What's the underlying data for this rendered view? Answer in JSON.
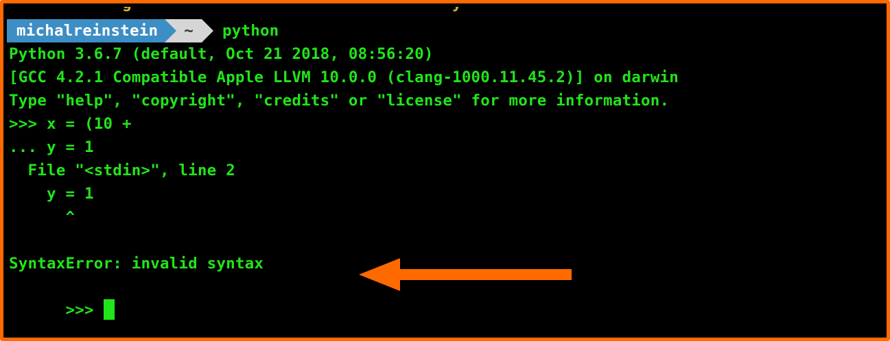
{
  "terminal": {
    "partial_top_line": "            g                                  y",
    "prompt": {
      "user": "michalreinstein",
      "directory": "~",
      "command": "python"
    },
    "lines": [
      "Python 3.6.7 (default, Oct 21 2018, 08:56:20)",
      "[GCC 4.2.1 Compatible Apple LLVM 10.0.0 (clang-1000.11.45.2)] on darwin",
      "Type \"help\", \"copyright\", \"credits\" or \"license\" for more information.",
      ">>> x = (10 +",
      "... y = 1",
      "  File \"<stdin>\", line 2",
      "    y = 1",
      "      ^",
      "SyntaxError: invalid syntax"
    ],
    "final_prompt": ">>>"
  },
  "colors": {
    "frame_border": "#ff6a00",
    "terminal_background": "#000000",
    "text_green": "#22e41a",
    "prompt_user_bg": "#3c8ec4",
    "prompt_dir_bg": "#d6d6d6",
    "annotation_arrow": "#ff6a00"
  },
  "icons": {
    "annotation": "left-arrow-icon",
    "cursor": "block-cursor"
  }
}
